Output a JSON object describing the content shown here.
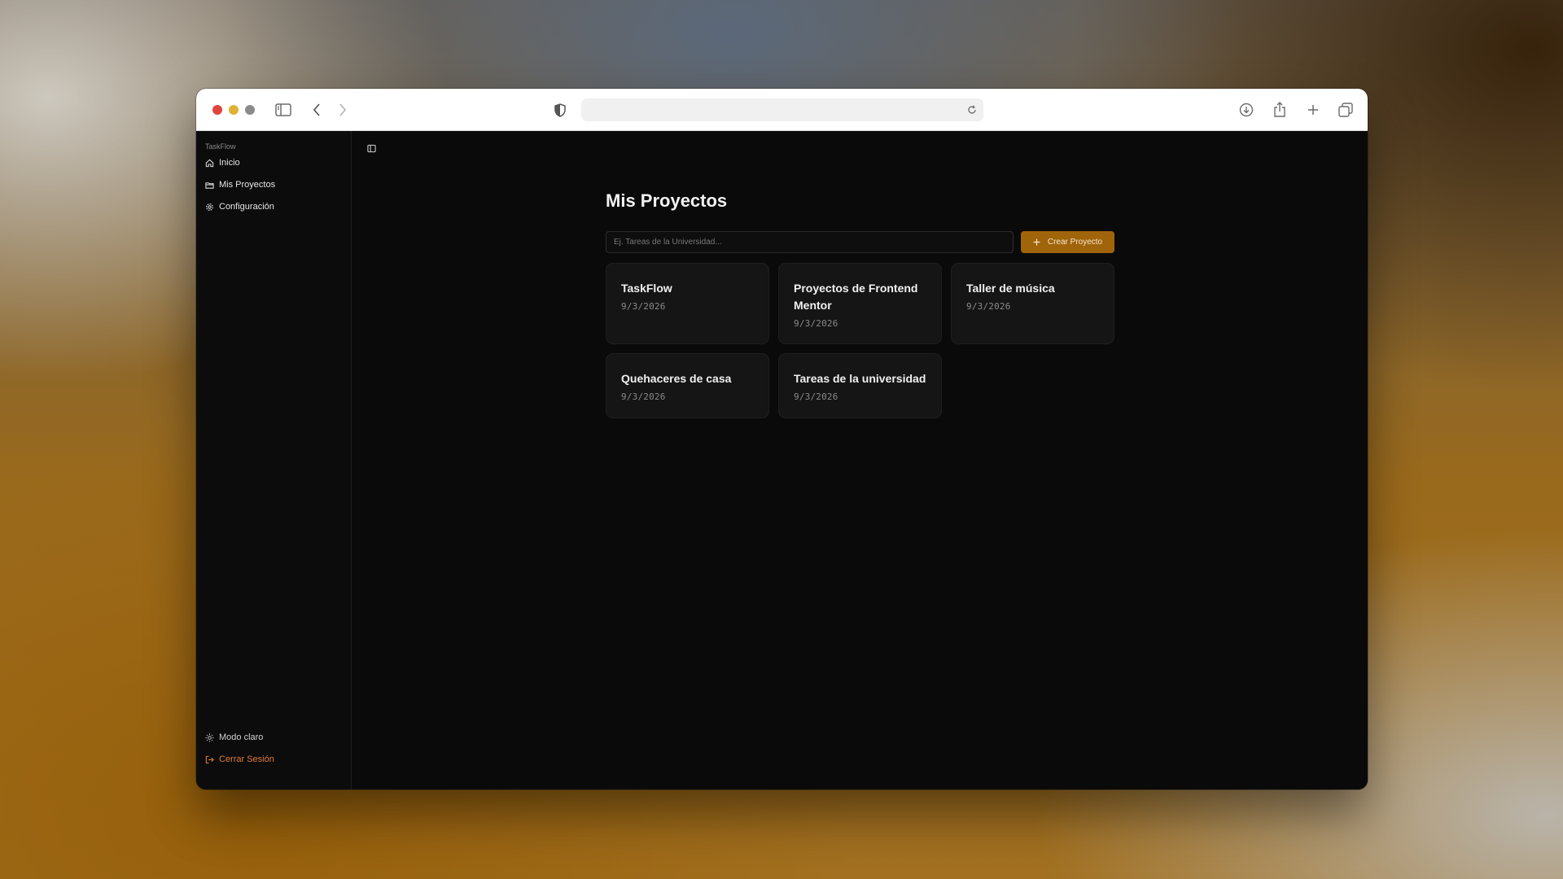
{
  "app": {
    "brand": "TaskFlow"
  },
  "sidebar": {
    "items": [
      {
        "label": "Inicio",
        "icon": "home-icon"
      },
      {
        "label": "Mis Proyectos",
        "icon": "folder-icon"
      },
      {
        "label": "Configuración",
        "icon": "gear-icon"
      }
    ],
    "footer": {
      "theme_label": "Modo claro",
      "logout_label": "Cerrar Sesión"
    }
  },
  "main": {
    "title": "Mis Proyectos",
    "search": {
      "value": "",
      "placeholder": "Ej. Tareas de la Universidad..."
    },
    "create_button": {
      "label": "Crear Proyecto"
    },
    "projects": [
      {
        "name": "TaskFlow",
        "date": "9/3/2026"
      },
      {
        "name": "Proyectos de Frontend Mentor",
        "date": "9/3/2026"
      },
      {
        "name": "Taller de música",
        "date": "9/3/2026"
      },
      {
        "name": "Quehaceres de casa",
        "date": "9/3/2026"
      },
      {
        "name": "Tareas de la universidad",
        "date": "9/3/2026"
      }
    ]
  },
  "colors": {
    "accent": "#a0640a",
    "logout": "#e07a3a",
    "background": "#0a0a0a",
    "card": "#151515"
  }
}
